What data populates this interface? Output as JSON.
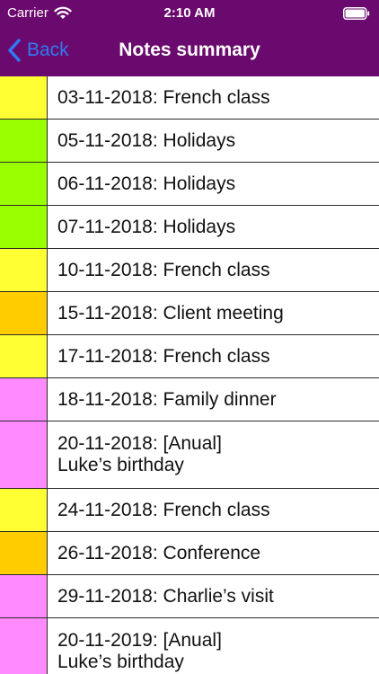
{
  "status_bar": {
    "carrier": "Carrier",
    "time": "2:10 AM"
  },
  "nav": {
    "back_label": "Back",
    "title": "Notes summary"
  },
  "colors": {
    "header_bg": "#6b0a6e",
    "back_blue": "#2f7bf5",
    "yellow": "#ffff33",
    "green": "#99ff00",
    "orange": "#ffcc00",
    "pink": "#ff8aff"
  },
  "notes": [
    {
      "text": "03-11-2018: French class",
      "color": "#ffff33"
    },
    {
      "text": "05-11-2018: Holidays",
      "color": "#99ff00"
    },
    {
      "text": "06-11-2018: Holidays",
      "color": "#99ff00"
    },
    {
      "text": "07-11-2018: Holidays",
      "color": "#99ff00"
    },
    {
      "text": "10-11-2018: French class",
      "color": "#ffff33"
    },
    {
      "text": "15-11-2018: Client meeting",
      "color": "#ffcc00"
    },
    {
      "text": "17-11-2018: French class",
      "color": "#ffff33"
    },
    {
      "text": "18-11-2018: Family dinner",
      "color": "#ff8aff"
    },
    {
      "text": "20-11-2018: [Anual]\nLuke’s birthday",
      "color": "#ff8aff"
    },
    {
      "text": "24-11-2018: French class",
      "color": "#ffff33"
    },
    {
      "text": "26-11-2018: Conference",
      "color": "#ffcc00"
    },
    {
      "text": "29-11-2018: Charlie’s visit",
      "color": "#ff8aff"
    },
    {
      "text": "20-11-2019: [Anual]\nLuke’s birthday",
      "color": "#ff8aff"
    }
  ]
}
